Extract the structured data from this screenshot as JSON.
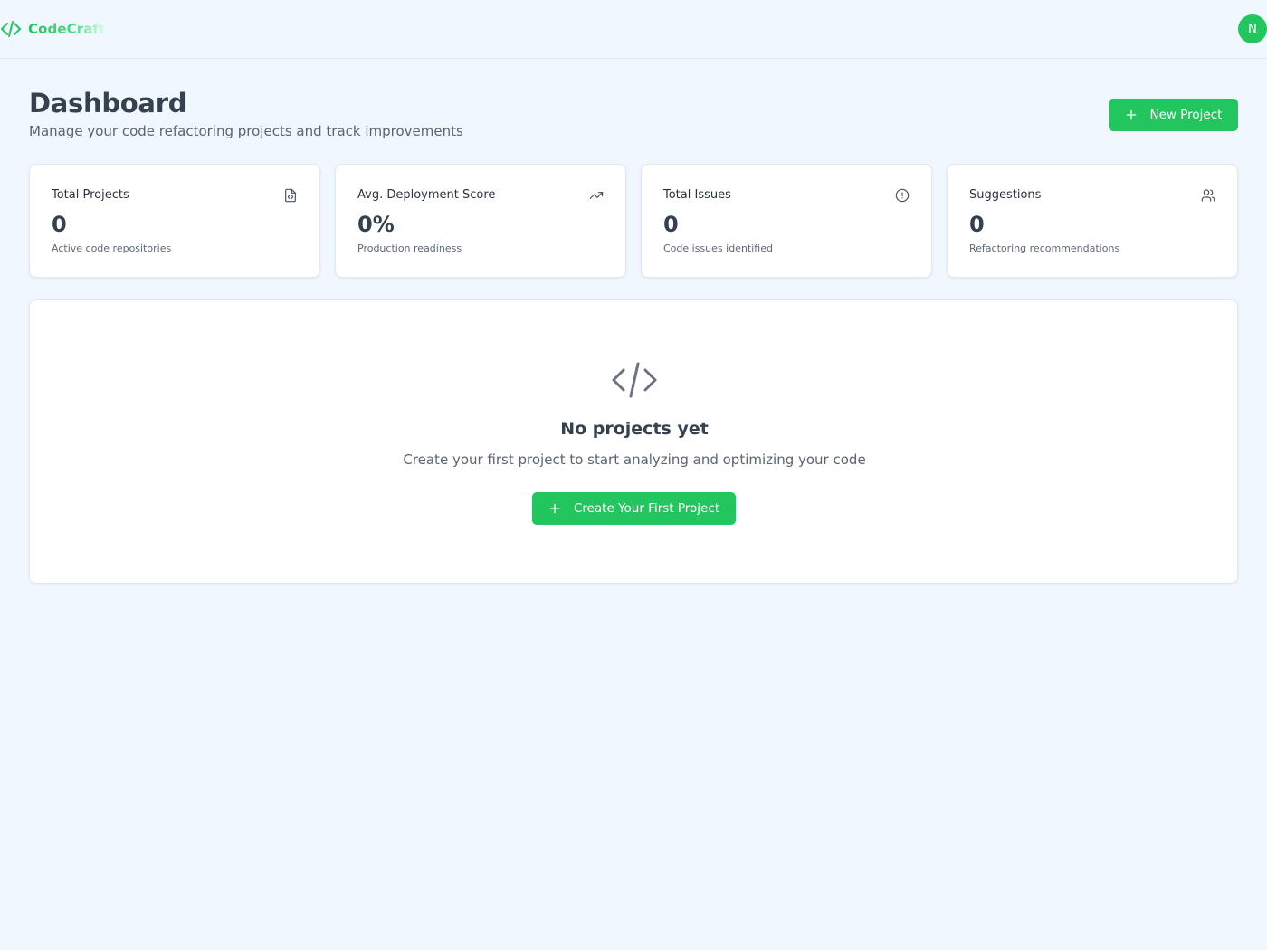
{
  "header": {
    "brand_name": "CodeCraft",
    "user_initial": "N"
  },
  "page": {
    "title": "Dashboard",
    "subtitle": "Manage your code refactoring projects and track improvements",
    "new_project_label": "New Project"
  },
  "stats": [
    {
      "label": "Total Projects",
      "value": "0",
      "description": "Active code repositories",
      "icon": "file-code-icon"
    },
    {
      "label": "Avg. Deployment Score",
      "value": "0%",
      "description": "Production readiness",
      "icon": "trending-up-icon"
    },
    {
      "label": "Total Issues",
      "value": "0",
      "description": "Code issues identified",
      "icon": "alert-circle-icon"
    },
    {
      "label": "Suggestions",
      "value": "0",
      "description": "Refactoring recommendations",
      "icon": "users-icon"
    }
  ],
  "empty_state": {
    "icon": "code-icon",
    "title": "No projects yet",
    "subtitle": "Create your first project to start analyzing and optimizing your code",
    "button_label": "Create Your First Project"
  },
  "colors": {
    "accent": "#22c55e",
    "background": "#f0f7fe",
    "card": "#ffffff",
    "heading": "#364150",
    "muted": "#5b6472"
  }
}
